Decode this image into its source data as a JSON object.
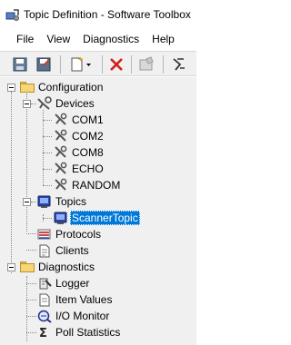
{
  "window": {
    "title": "Topic Definition - Software Toolbox",
    "app_icon": "topic-definition-app-icon"
  },
  "menu": [
    "File",
    "View",
    "Diagnostics",
    "Help"
  ],
  "toolbar": {
    "buttons": [
      "save-icon",
      "edit-icon",
      "new-dropdown-icon",
      "delete-icon",
      "properties-icon",
      "tools-icon"
    ]
  },
  "tree": {
    "configuration": "Configuration",
    "devices": "Devices",
    "device_items": [
      "COM1",
      "COM2",
      "COM8",
      "ECHO",
      "RANDOM"
    ],
    "topics": "Topics",
    "topic_items": [
      "ScannerTopic"
    ],
    "protocols": "Protocols",
    "clients": "Clients",
    "diagnostics": "Diagnostics",
    "diagnostic_items": [
      "Logger",
      "Item Values",
      "I/O Monitor",
      "Poll Statistics"
    ],
    "selected_item": "ScannerTopic"
  },
  "colors": {
    "selection": "#0078d7",
    "tree_background": "#f0f0f0",
    "folder": "#f6d677"
  }
}
